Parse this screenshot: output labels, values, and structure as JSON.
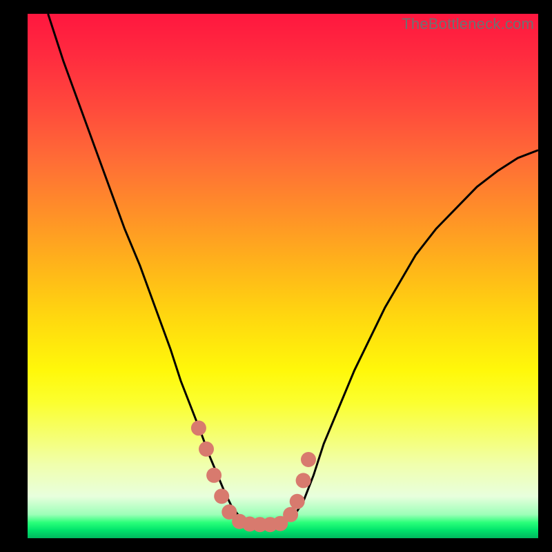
{
  "watermark": "TheBottleneck.com",
  "colors": {
    "page_bg": "#000000",
    "watermark_text": "#707070",
    "curve_stroke": "#000000",
    "marker_fill": "#d87a6e",
    "gradient_top": "#ff173f",
    "gradient_bottom": "#00b85f"
  },
  "chart_data": {
    "type": "line",
    "title": "",
    "xlabel": "",
    "ylabel": "",
    "xlim": [
      0,
      100
    ],
    "ylim": [
      0,
      100
    ],
    "grid": false,
    "legend": false,
    "note": "Axes have no tick labels; values are mapped to fractional plot coordinates (0–100 each axis). y=100 is top, y=0 is bottom.",
    "series": [
      {
        "name": "main-curve",
        "x": [
          4,
          7,
          10,
          13,
          16,
          19,
          22,
          25,
          28,
          30,
          32,
          34,
          35.5,
          37,
          38.5,
          40,
          42,
          44,
          46,
          48,
          50,
          52,
          54,
          56,
          58,
          61,
          64,
          67,
          70,
          73,
          76,
          80,
          84,
          88,
          92,
          96,
          100
        ],
        "y": [
          100,
          91,
          83,
          75,
          67,
          59,
          52,
          44,
          36,
          30,
          25,
          20,
          16,
          12.5,
          9,
          6,
          3.5,
          2.8,
          2.6,
          2.6,
          2.8,
          4,
          7,
          12,
          18,
          25,
          32,
          38,
          44,
          49,
          54,
          59,
          63,
          67,
          70,
          72.5,
          74
        ]
      }
    ],
    "markers": {
      "description": "Highlighted points on the curve near its minimum, drawn as salmon dots.",
      "color": "#d87a6e",
      "radius_px": 11,
      "points_xy": [
        [
          33.5,
          21
        ],
        [
          35.0,
          17
        ],
        [
          36.5,
          12
        ],
        [
          38.0,
          8
        ],
        [
          39.5,
          5
        ],
        [
          41.5,
          3.2
        ],
        [
          43.5,
          2.7
        ],
        [
          45.5,
          2.6
        ],
        [
          47.5,
          2.6
        ],
        [
          49.5,
          2.8
        ],
        [
          51.5,
          4.5
        ],
        [
          52.8,
          7
        ],
        [
          54.0,
          11
        ],
        [
          55.0,
          15
        ]
      ]
    }
  }
}
